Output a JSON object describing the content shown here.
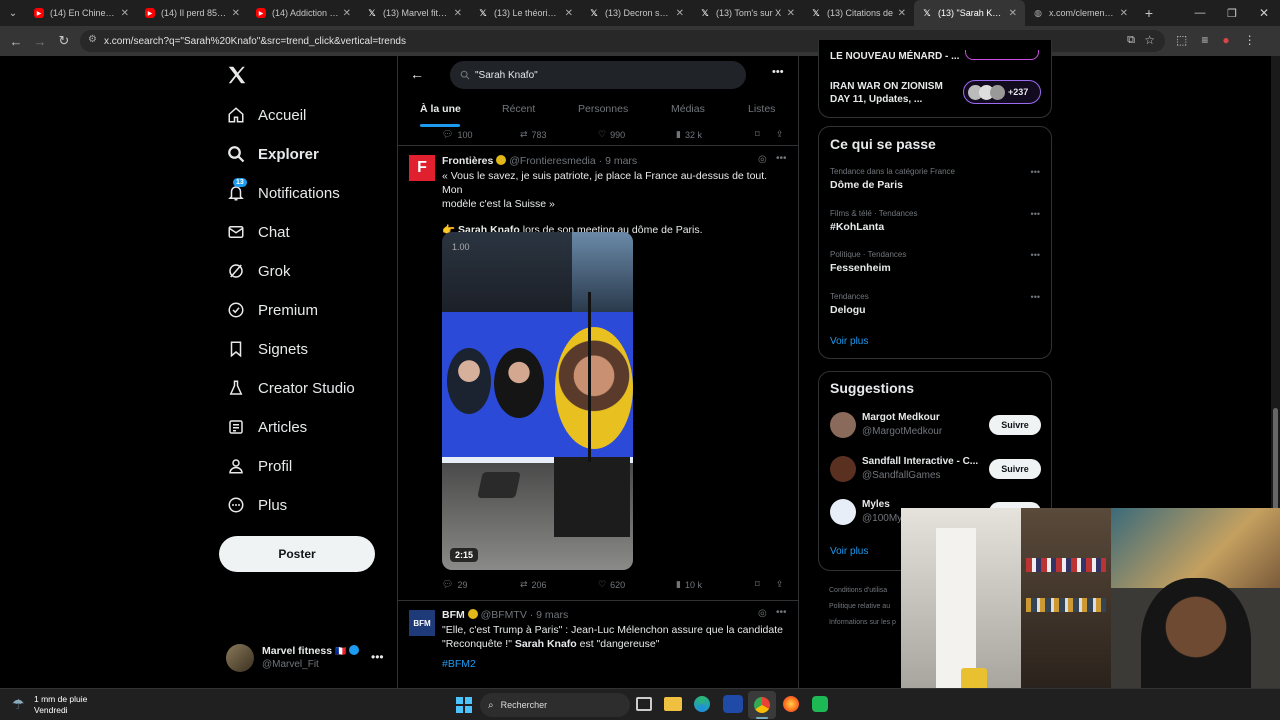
{
  "browser": {
    "tabs": [
      {
        "title": "(14) En Chine, ce",
        "icon": "youtube-icon",
        "color": "#ff0000"
      },
      {
        "title": "(14) Il perd 85 kg",
        "icon": "youtube-icon",
        "color": "#ff0000"
      },
      {
        "title": "(14) Addiction au",
        "icon": "youtube-icon",
        "color": "#ff0000"
      },
      {
        "title": "(13) Marvel fitnes",
        "icon": "x-icon",
        "color": "#ffffff"
      },
      {
        "title": "(13) Le théoricien",
        "icon": "x-icon",
        "color": "#ffffff"
      },
      {
        "title": "(13) Decron sur X",
        "icon": "x-icon",
        "color": "#ffffff"
      },
      {
        "title": "(13) Tom's sur X",
        "icon": "x-icon",
        "color": "#ffffff"
      },
      {
        "title": "(13) Citations de",
        "icon": "x-icon",
        "color": "#ffffff"
      },
      {
        "title": "(13) \"Sarah Knafo",
        "icon": "x-icon",
        "color": "#ffffff",
        "active": true
      },
      {
        "title": "x.com/clement_m",
        "icon": "globe-icon",
        "color": "#ffffff"
      }
    ],
    "url": "x.com/search?q=\"Sarah%20Knafo\"&src=trend_click&vertical=trends"
  },
  "sidebar": {
    "items": [
      {
        "label": "Accueil",
        "icon": "home-icon",
        "bold": false
      },
      {
        "label": "Explorer",
        "icon": "search-icon",
        "bold": true
      },
      {
        "label": "Notifications",
        "icon": "bell-icon",
        "bold": false,
        "badge": "13"
      },
      {
        "label": "Chat",
        "icon": "mail-icon",
        "bold": false
      },
      {
        "label": "Grok",
        "icon": "grok-icon",
        "bold": false
      },
      {
        "label": "Premium",
        "icon": "premium-icon",
        "bold": false
      },
      {
        "label": "Signets",
        "icon": "bookmark-icon",
        "bold": false
      },
      {
        "label": "Creator Studio",
        "icon": "flask-icon",
        "bold": false
      },
      {
        "label": "Articles",
        "icon": "article-icon",
        "bold": false
      },
      {
        "label": "Profil",
        "icon": "person-icon",
        "bold": false
      },
      {
        "label": "Plus",
        "icon": "more-circle-icon",
        "bold": false
      }
    ],
    "post_button": "Poster",
    "account": {
      "name": "Marvel fitness",
      "flag": "🇫🇷",
      "handle": "@Marvel_Fit"
    }
  },
  "search": {
    "query": "\"Sarah Knafo\"",
    "tabs": [
      "À la une",
      "Récent",
      "Personnes",
      "Médias",
      "Listes"
    ],
    "active_tab": "À la une"
  },
  "top_actions": {
    "replies": "100",
    "reposts": "783",
    "likes": "990",
    "views": "32 k"
  },
  "tweet1": {
    "author": "Frontières",
    "avatar_letter": "F",
    "handle": "@Frontieresmedia",
    "time": "· 9 mars",
    "text_line1": "« Vous le savez, je suis patriote, je place la France au-dessus de tout. Mon",
    "text_line2": "modèle c'est la Suisse »",
    "text3_emoji": "👉",
    "text3_bold": "Sarah Knafo",
    "text3_rest": " lors de son meeting au dôme de Paris.",
    "video_speed": "1.00",
    "video_duration": "2:15",
    "replies": "29",
    "reposts": "206",
    "likes": "620",
    "views": "10 k"
  },
  "tweet2": {
    "author": "BFM",
    "avatar_text": "BFM",
    "handle": "@BFMTV",
    "time": "· 9 mars",
    "text_line1": "\"Elle, c'est Trump à Paris\" : Jean-Luc Mélenchon assure que la candidate",
    "text_line2_a": "\"Reconquête !\" ",
    "text_line2_bold": "Sarah Knafo",
    "text_line2_b": " est \"dangereuse\"",
    "hashtag": "#BFM2"
  },
  "spaces": [
    {
      "title": "LE NOUVEAU MÉNARD - ..."
    },
    {
      "title_line1": "IRAN WAR ON ZIONISM",
      "title_line2": "DAY 11, Updates, ...",
      "count": "+237"
    }
  ],
  "trends": {
    "title": "Ce qui se passe",
    "items": [
      {
        "meta": "Tendance dans la catégorie France",
        "name": "Dôme de Paris"
      },
      {
        "meta": "Films & télé · Tendances",
        "name": "#KohLanta"
      },
      {
        "meta": "Politique · Tendances",
        "name": "Fessenheim"
      },
      {
        "meta": "Tendances",
        "name": "Delogu"
      }
    ],
    "more": "Voir plus"
  },
  "suggestions": {
    "title": "Suggestions",
    "items": [
      {
        "name": "Margot Medkour",
        "handle": "@MargotMedkour",
        "button": "Suivre"
      },
      {
        "name": "Sandfall Interactive - C...",
        "handle": "@SandfallGames",
        "button": "Suivre"
      },
      {
        "name": "Myles",
        "handle": "@100My",
        "button": "Suivre"
      }
    ],
    "more": "Voir plus"
  },
  "footer_links": [
    "Conditions d'utilisa",
    "Politique relative au",
    "Informations sur les p"
  ],
  "taskbar": {
    "weather_line1": "1 mm de pluie",
    "weather_line2": "Vendredi",
    "search_placeholder": "Rechercher"
  }
}
